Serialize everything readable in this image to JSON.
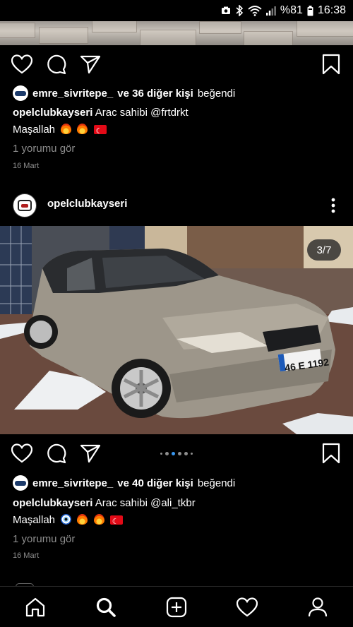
{
  "status_bar": {
    "battery": "%81",
    "time": "16:38"
  },
  "posts": [
    {
      "liked_by": {
        "user": "emre_sivritepe_",
        "others": "ve 36 diğer kişi",
        "suffix": "beğendi"
      },
      "caption": {
        "user": "opelclubkayseri",
        "text": "Arac sahibi @frtdrkt",
        "line2": "Maşallah"
      },
      "comments_link": "1 yorumu gör",
      "date": "16 Mart"
    },
    {
      "header": {
        "username": "opelclubkayseri"
      },
      "image": {
        "counter": "3/7",
        "plate": "46 E 1192",
        "alt_subject": "silver-sedan-car"
      },
      "liked_by": {
        "user": "emre_sivritepe_",
        "others": "ve 40 diğer kişi",
        "suffix": "beğendi"
      },
      "caption": {
        "user": "opelclubkayseri",
        "text": "Arac sahibi @ali_tkbr",
        "line2": "Maşallah"
      },
      "comments_link": "1 yorumu gör",
      "date": "16 Mart"
    }
  ],
  "nav": [
    "home-icon",
    "search-icon",
    "new-post-icon",
    "activity-heart-icon",
    "profile-icon"
  ],
  "colors": {
    "background": "#000000",
    "secondary_text": "#8e8e8e",
    "active_dot": "#3897f0"
  }
}
